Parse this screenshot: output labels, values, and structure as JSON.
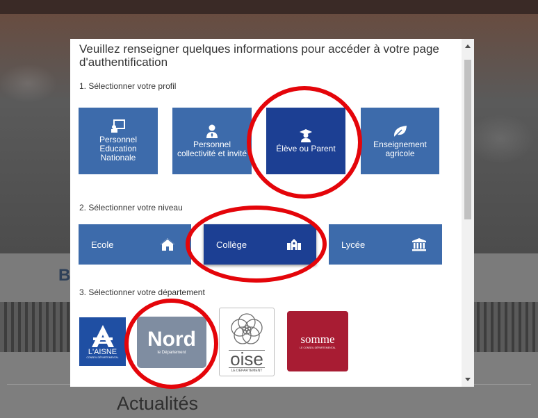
{
  "background": {
    "band_letter": "B",
    "news_heading": "Actualités"
  },
  "modal": {
    "title": "Veuillez renseigner quelques informations pour accéder à votre page d'authentification",
    "section_profile": "1. Sélectionner votre profil",
    "section_level": "2. Sélectionner votre niveau",
    "section_department": "3. Sélectionner votre département",
    "profiles": [
      {
        "label": "Personnel Education Nationale",
        "icon": "board-icon",
        "selected": false
      },
      {
        "label": "Personnel collectivité et invité",
        "icon": "user-tie-icon",
        "selected": false
      },
      {
        "label": "Élève ou Parent",
        "icon": "graduate-icon",
        "selected": true
      },
      {
        "label": "Enseignement agricole",
        "icon": "leaf-icon",
        "selected": false
      }
    ],
    "levels": [
      {
        "label": "Ecole",
        "icon": "house-icon",
        "selected": false
      },
      {
        "label": "Collège",
        "icon": "school-icon",
        "selected": true
      },
      {
        "label": "Lycée",
        "icon": "institution-icon",
        "selected": false
      }
    ],
    "departments": [
      {
        "name": "L'AISNE",
        "sub": "CONSEIL DÉPARTEMENTAL"
      },
      {
        "name": "Nord",
        "sub": "le Département"
      },
      {
        "name": "oise",
        "sub": "LE DÉPARTEMENT"
      },
      {
        "name": "somme",
        "sub": "LE CONSEIL DÉPARTEMENTAL"
      }
    ]
  },
  "colors": {
    "tile": "#3d6bab",
    "tile_selected": "#1c3f93",
    "annotation": "#e4050a"
  }
}
